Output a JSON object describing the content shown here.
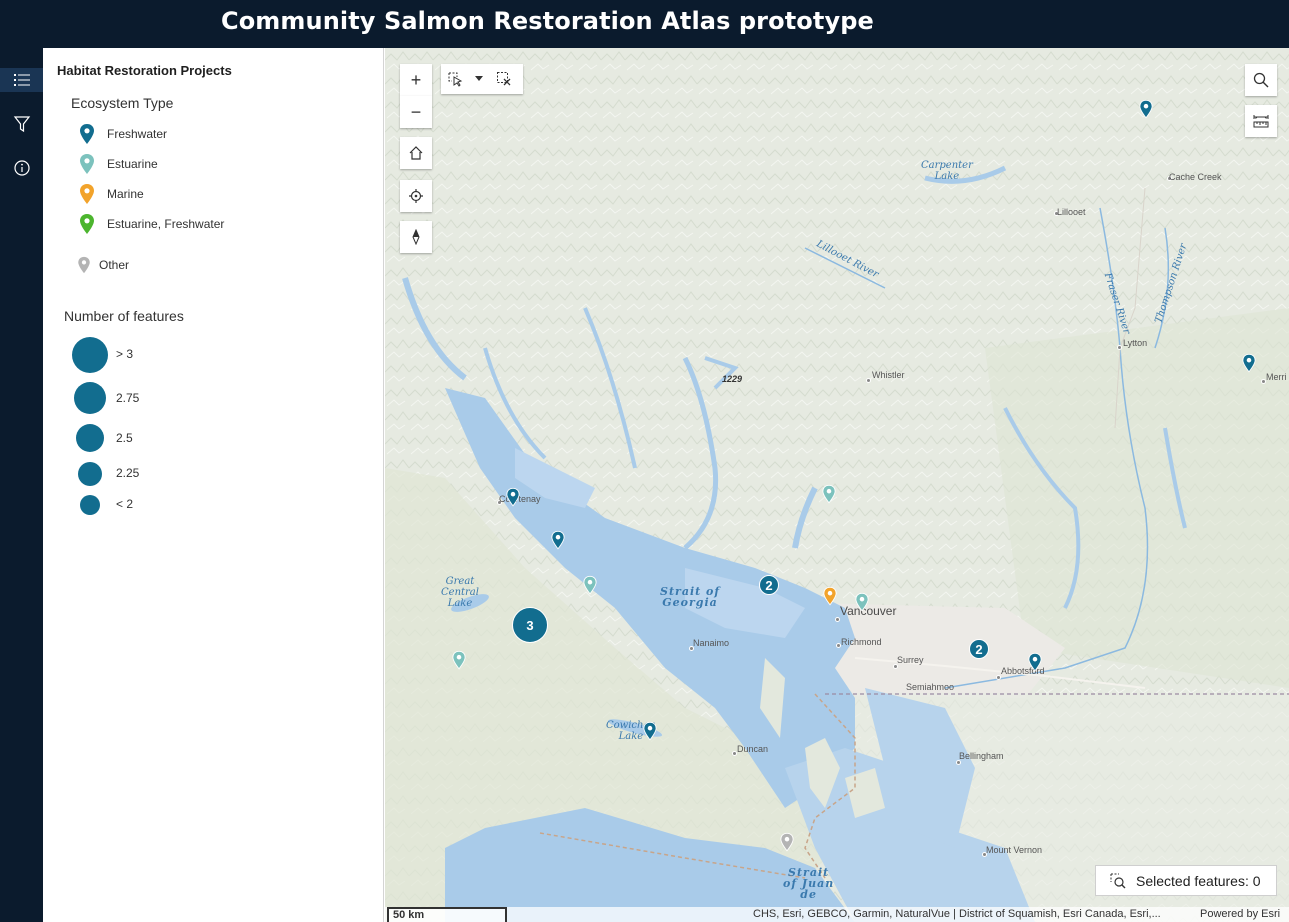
{
  "header": {
    "title": "Community Salmon Restoration Atlas prototype"
  },
  "rail": {
    "items": [
      {
        "name": "layer-list",
        "icon": "list-icon",
        "active": true
      },
      {
        "name": "filter",
        "icon": "filter-icon",
        "active": false
      },
      {
        "name": "about",
        "icon": "info-icon",
        "active": false
      }
    ]
  },
  "legend": {
    "layer_title": "Habitat Restoration Projects",
    "ecosystem_title": "Ecosystem Type",
    "ecosystem_items": [
      {
        "label": "Freshwater",
        "color": "#126d8f"
      },
      {
        "label": "Estuarine",
        "color": "#7cc2bd"
      },
      {
        "label": "Marine",
        "color": "#f2a32b"
      },
      {
        "label": "Estuarine, Freshwater",
        "color": "#4cb52e"
      },
      {
        "label": "Other",
        "color": "#b4b4b4"
      }
    ],
    "size_title": "Number of features",
    "size_items": [
      {
        "label": "> 3"
      },
      {
        "label": "2.75"
      },
      {
        "label": "2.5"
      },
      {
        "label": "2.25"
      },
      {
        "label": "< 2"
      }
    ]
  },
  "map": {
    "tools": {
      "zoom_in": "+",
      "zoom_out": "−"
    },
    "places": {
      "cache_creek": "Cache Creek",
      "lillooet": "Lillooet",
      "lytton": "Lytton",
      "merritt": "Merri",
      "whistler": "Whistler",
      "courtenay": "Courtenay",
      "vancouver": "Vancouver",
      "richmond": "Richmond",
      "surrey": "Surrey",
      "semiahmoo": "Semiahmoo",
      "abbotsford": "Abbotsford",
      "nanaimo": "Nanaimo",
      "duncan": "Duncan",
      "bellingham": "Bellingham",
      "mount_vernon": "Mount Vernon",
      "elevation": "1229"
    },
    "water_labels": {
      "carpenter_lake": "Carpenter\nLake",
      "lillooet_river": "Lillooet River",
      "fraser_river": "Fraser River",
      "thompson_river": "Thompson River",
      "great_central_lake": "Great\nCentral\nLake",
      "strait_of_georgia": "Strait of\nGeorgia",
      "cowichan_lake": "Cowichan\nLake",
      "strait_juan_de": "Strait\nof Juan\nde"
    },
    "clusters": [
      {
        "count": "3"
      },
      {
        "count": "2"
      },
      {
        "count": "2"
      }
    ],
    "selected_features": "Selected features: 0",
    "scale": "50 km",
    "attribution": "CHS, Esri, GEBCO, Garmin, NaturalVue | District of Squamish, Esri Canada, Esri,...",
    "powered_by": "Powered by Esri"
  }
}
